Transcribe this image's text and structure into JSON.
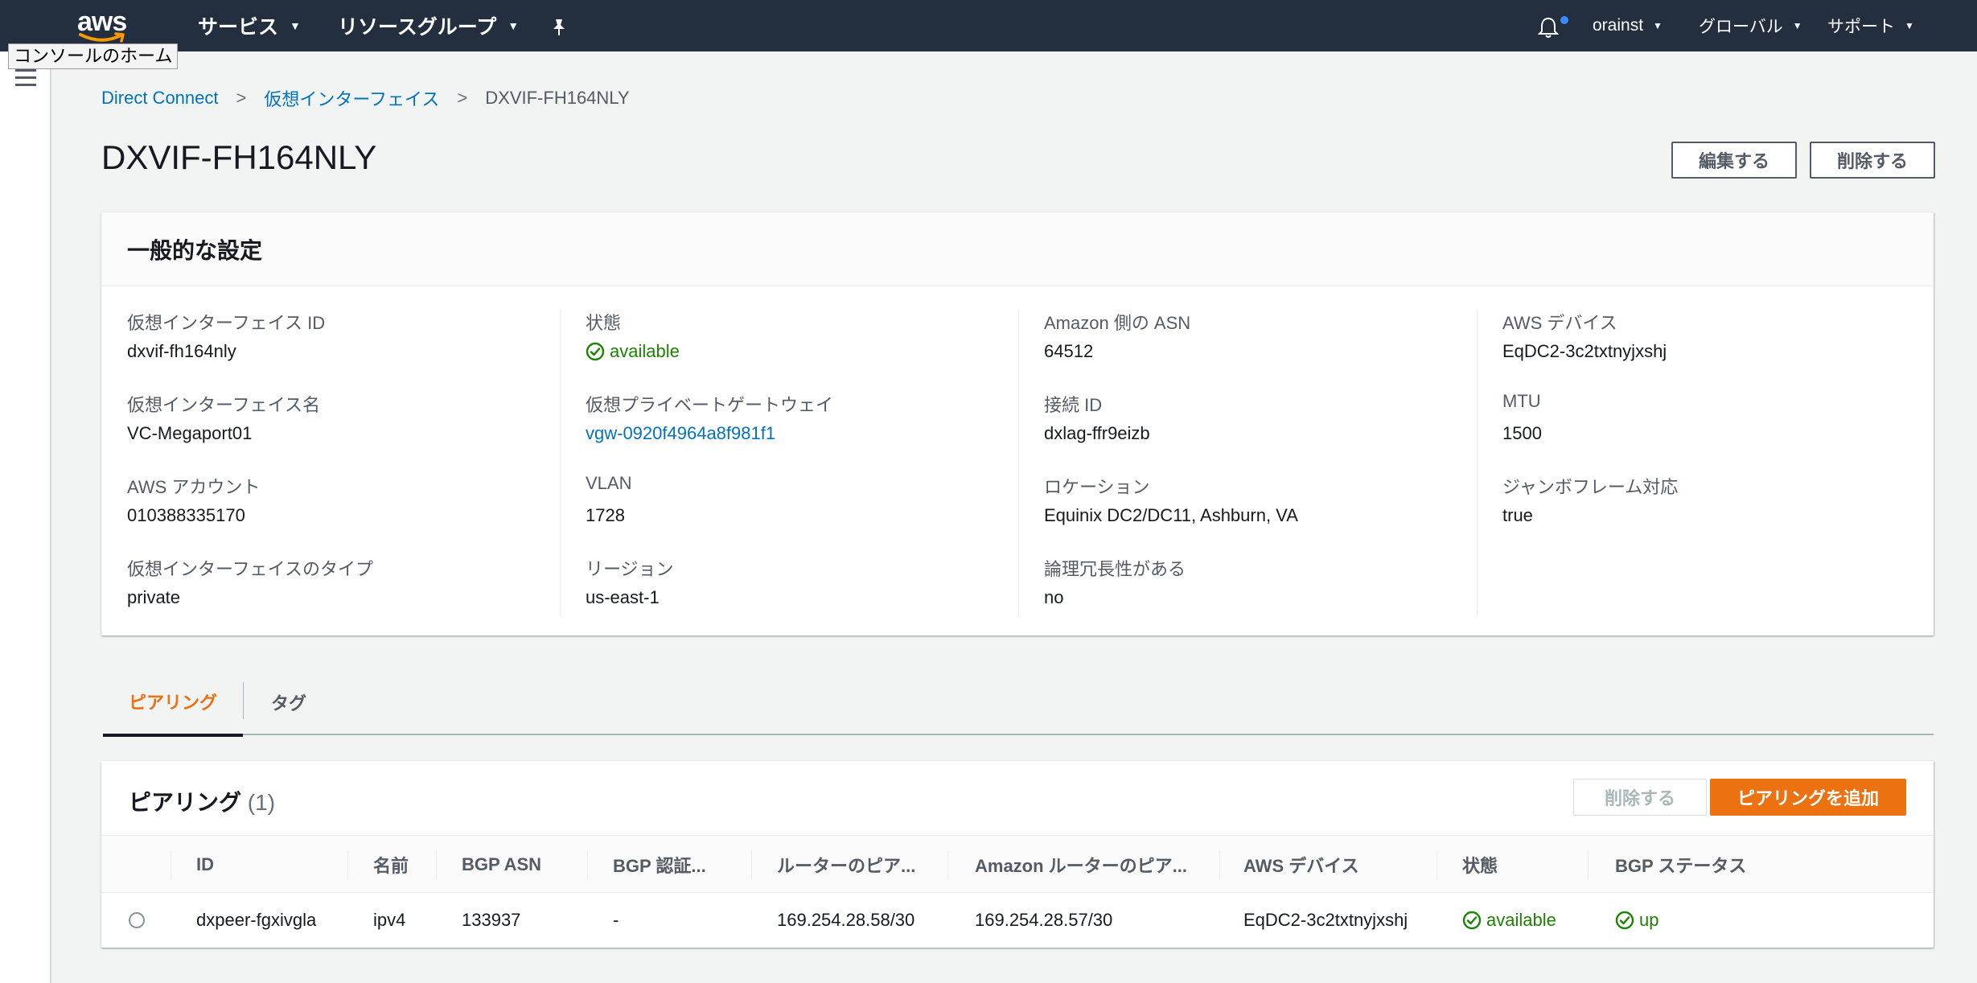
{
  "nav": {
    "services": "サービス",
    "resource_groups": "リソースグループ",
    "user": "orainst",
    "region": "グローバル",
    "support": "サポート",
    "tooltip": "コンソールのホーム"
  },
  "breadcrumb": {
    "root": "Direct Connect",
    "parent": "仮想インターフェイス",
    "current": "DXVIF-FH164NLY"
  },
  "page": {
    "title": "DXVIF-FH164NLY",
    "edit_button": "編集する",
    "delete_button": "削除する"
  },
  "general": {
    "title": "一般的な設定",
    "columns": [
      [
        {
          "label": "仮想インターフェイス ID",
          "value": "dxvif-fh164nly"
        },
        {
          "label": "仮想インターフェイス名",
          "value": "VC-Megaport01"
        },
        {
          "label": "AWS アカウント",
          "value": "010388335170"
        },
        {
          "label": "仮想インターフェイスのタイプ",
          "value": "private"
        }
      ],
      [
        {
          "label": "状態",
          "value": "available"
        },
        {
          "label": "仮想プライベートゲートウェイ",
          "value": "vgw-0920f4964a8f981f1"
        },
        {
          "label": "VLAN",
          "value": "1728"
        },
        {
          "label": "リージョン",
          "value": "us-east-1"
        }
      ],
      [
        {
          "label": "Amazon 側の ASN",
          "value": "64512"
        },
        {
          "label": "接続 ID",
          "value": "dxlag-ffr9eizb"
        },
        {
          "label": "ロケーション",
          "value": "Equinix DC2/DC11, Ashburn, VA"
        },
        {
          "label": "論理冗長性がある",
          "value": "no"
        }
      ],
      [
        {
          "label": "AWS デバイス",
          "value": "EqDC2-3c2txtnyjxshj"
        },
        {
          "label": "MTU",
          "value": "1500"
        },
        {
          "label": "ジャンボフレーム対応",
          "value": "true"
        }
      ]
    ]
  },
  "tabs": [
    "ピアリング",
    "タグ"
  ],
  "peering": {
    "title": "ピアリング",
    "count": "(1)",
    "delete_button": "削除する",
    "add_button": "ピアリングを追加",
    "headers": [
      "ID",
      "名前",
      "BGP ASN",
      "BGP 認証...",
      "ルーターのピア...",
      "Amazon ルーターのピア...",
      "AWS デバイス",
      "状態",
      "BGP ステータス"
    ],
    "rows": [
      [
        "dxpeer-fgxivgla",
        "ipv4",
        "133937",
        "-",
        "169.254.28.58/30",
        "169.254.28.57/30",
        "EqDC2-3c2txtnyjxshj",
        "available",
        "up"
      ]
    ]
  },
  "colors": {
    "nav_bg": "#232f3e",
    "link": "#0073bb",
    "accent": "#ec7211",
    "success": "#1d8102"
  }
}
